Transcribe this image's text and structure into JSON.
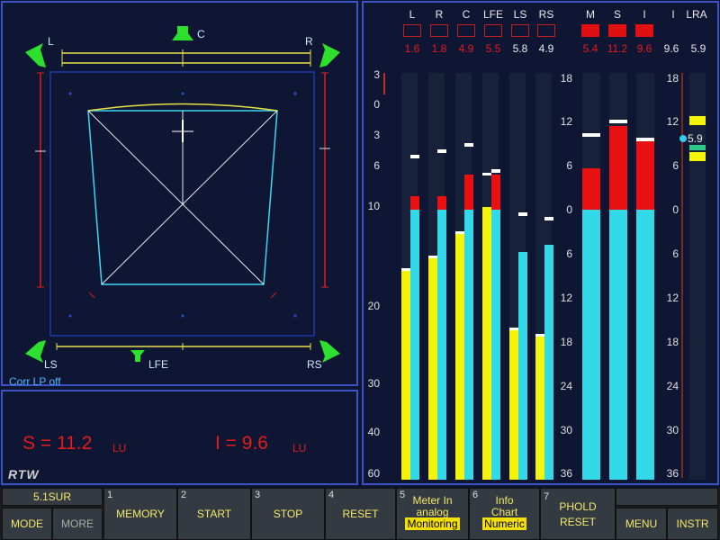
{
  "surround": {
    "labels": {
      "L": "L",
      "C": "C",
      "R": "R",
      "LS": "LS",
      "LFE": "LFE",
      "RS": "RS"
    },
    "status": "Corr LP off"
  },
  "loudness": {
    "s_label": "S = 11.2",
    "s_unit": "LU",
    "i_label": "I = 9.6",
    "i_unit": "LU",
    "logo": "RTW"
  },
  "meters": {
    "channels": [
      {
        "name": "L",
        "value": "1.6",
        "red": true
      },
      {
        "name": "R",
        "value": "1.8",
        "red": true
      },
      {
        "name": "C",
        "value": "4.9",
        "red": true
      },
      {
        "name": "LFE",
        "value": "5.5",
        "red": true
      },
      {
        "name": "LS",
        "value": "5.8",
        "red": false
      },
      {
        "name": "RS",
        "value": "4.9",
        "red": false
      }
    ],
    "loudness": [
      {
        "name": "M",
        "value": "5.4"
      },
      {
        "name": "S",
        "value": "11.2"
      },
      {
        "name": "I",
        "value": "9.6"
      }
    ],
    "integrated": {
      "name": "I",
      "value": "9.6"
    },
    "lra": {
      "name": "LRA",
      "value": "5.9",
      "marker": "5.9"
    },
    "left_scale": [
      "3",
      "0",
      "3",
      "6",
      "10",
      "20",
      "30",
      "40",
      "60"
    ],
    "mid_scale": [
      "18",
      "12",
      "6",
      "0",
      "6",
      "12",
      "18",
      "24",
      "30",
      "36"
    ],
    "right_scale": [
      "18",
      "12",
      "6",
      "0",
      "6",
      "12",
      "18",
      "24",
      "30",
      "36"
    ]
  },
  "softkeys": {
    "mode_top": "5.1SUR",
    "mode": "MODE",
    "more": "MORE",
    "k1_num": "1",
    "k1": "MEMORY",
    "k2_num": "2",
    "k2": "START",
    "k3_num": "3",
    "k3": "STOP",
    "k4_num": "4",
    "k4": "RESET",
    "k5_num": "5",
    "k5a": "Meter In",
    "k5b": "analog",
    "k5c": "Monitoring",
    "k6_num": "6",
    "k6a": "Info",
    "k6b": "Chart",
    "k6c": "Numeric",
    "k7_num": "7",
    "k7a": "PHOLD",
    "k7b": "RESET",
    "menu": "MENU",
    "instr": "INSTR"
  }
}
